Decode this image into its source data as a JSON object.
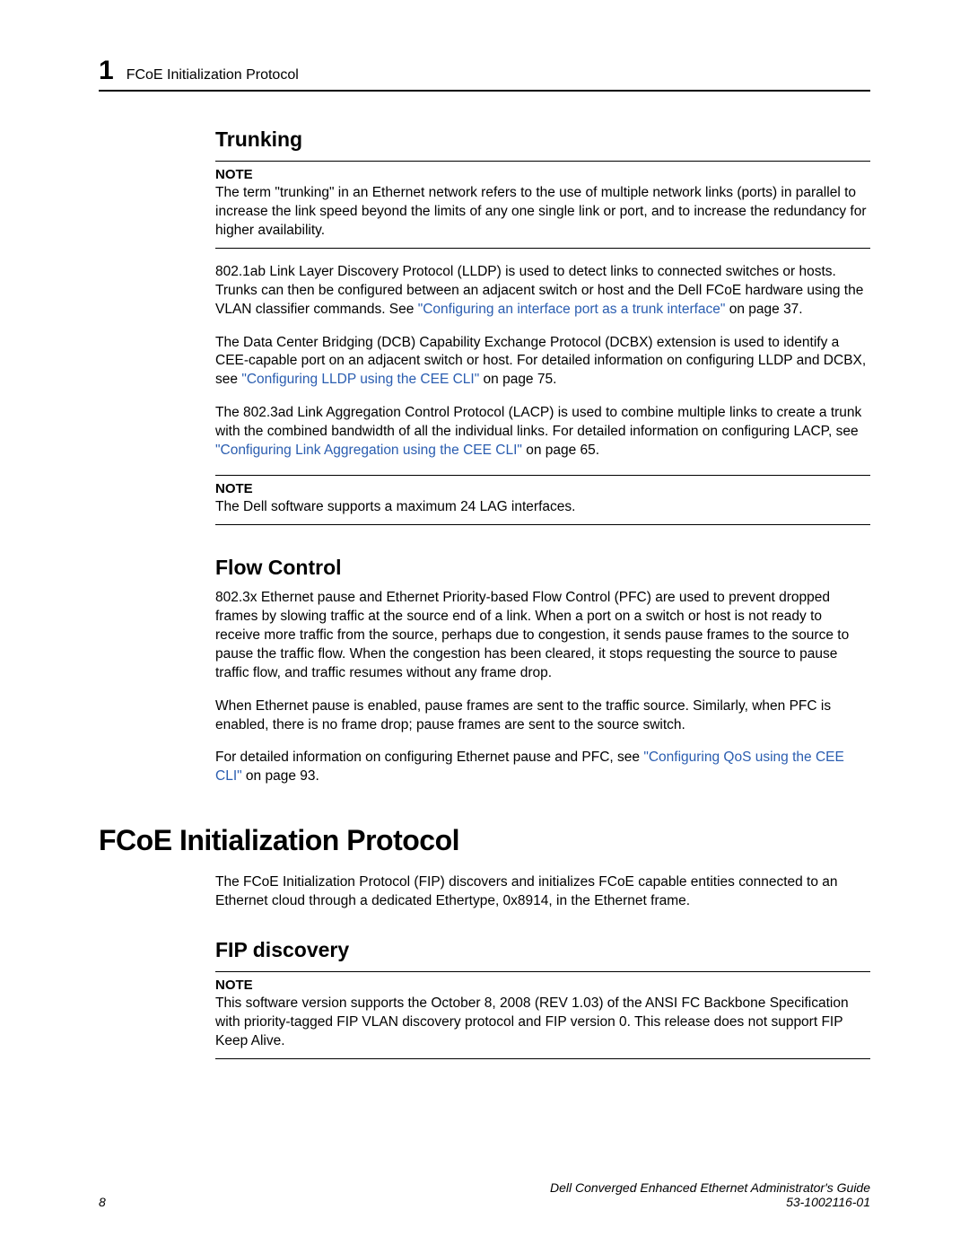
{
  "header": {
    "chapter_number": "1",
    "chapter_title": "FCoE Initialization Protocol"
  },
  "trunking": {
    "heading": "Trunking",
    "note1_label": "NOTE",
    "note1_body": "The term \"trunking\" in an Ethernet network refers to the use of multiple network links (ports) in parallel to increase the link speed beyond the limits of any one single link or port, and to increase the redundancy for higher availability.",
    "p1_a": "802.1ab Link Layer Discovery Protocol (LLDP) is used to detect links to connected switches or hosts. Trunks can then be configured between an adjacent switch or host and the Dell FCoE hardware using the VLAN classifier commands. See ",
    "p1_link": "\"Configuring an interface port as a trunk interface\"",
    "p1_b": " on page 37.",
    "p2_a": "The Data Center Bridging (DCB) Capability Exchange Protocol (DCBX) extension is used to identify a CEE-capable port on an adjacent switch or host. For detailed information on configuring LLDP and DCBX, see ",
    "p2_link": "\"Configuring LLDP using the CEE CLI\"",
    "p2_b": " on page 75.",
    "p3_a": "The 802.3ad Link Aggregation Control Protocol (LACP) is used to combine multiple links to create a trunk with the combined bandwidth of all the individual links. For detailed information on configuring LACP, see ",
    "p3_link": "\"Configuring Link Aggregation using the CEE CLI\"",
    "p3_b": " on page 65.",
    "note2_label": "NOTE",
    "note2_body": "The Dell software supports a maximum 24 LAG interfaces."
  },
  "flow_control": {
    "heading": "Flow Control",
    "p1": "802.3x Ethernet pause and Ethernet Priority-based Flow Control (PFC) are used to prevent dropped frames by slowing traffic at the source end of a link. When a port on a switch or host is not ready to receive more traffic from the source, perhaps due to congestion, it sends pause frames to the source to pause the traffic flow. When the congestion has been cleared, it stops requesting the source to pause traffic flow, and traffic resumes without any frame drop.",
    "p2": "When Ethernet pause is enabled, pause frames are sent to the traffic source. Similarly, when PFC is enabled, there is no frame drop; pause frames are sent to the source switch.",
    "p3_a": "For detailed information on configuring Ethernet pause and PFC, see ",
    "p3_link": "\"Configuring QoS using the CEE CLI\"",
    "p3_b": " on page 93."
  },
  "fip": {
    "heading": "FCoE Initialization Protocol",
    "intro": "The FCoE Initialization Protocol (FIP) discovers and initializes FCoE capable entities connected to an Ethernet cloud through a dedicated Ethertype, 0x8914, in the Ethernet frame.",
    "discovery_heading": "FIP discovery",
    "note_label": "NOTE",
    "note_body": "This software version supports the October 8, 2008 (REV 1.03) of the ANSI FC Backbone Specification with priority-tagged FIP VLAN discovery protocol and FIP version 0. This release does not support FIP Keep Alive."
  },
  "footer": {
    "page_number": "8",
    "doc_title": "Dell Converged Enhanced Ethernet Administrator's Guide",
    "doc_id": "53-1002116-01"
  }
}
